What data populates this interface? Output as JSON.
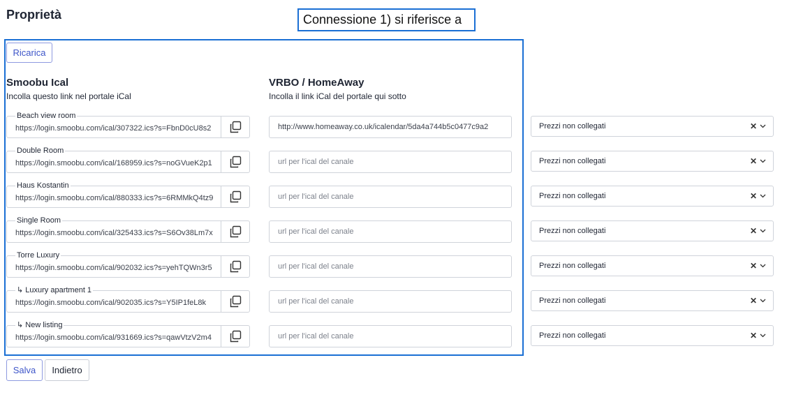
{
  "page": {
    "title": "Proprietà"
  },
  "callout": {
    "text": "Connessione 1) si riferisce a"
  },
  "buttons": {
    "reload": "Ricarica",
    "save": "Salva",
    "back": "Indietro"
  },
  "smoobu_column": {
    "heading": "Smoobu Ical",
    "subtitle": "Incolla questo link nel portale iCal"
  },
  "channel_column": {
    "heading": "VRBO / HomeAway",
    "subtitle": "Incolla il link iCal del portale qui sotto"
  },
  "rows": [
    {
      "name": "Beach view room",
      "ical_url": "https://login.smoobu.com/ical/307322.ics?s=FbnD0cU8s2",
      "channel_value": "http://www.homeaway.co.uk/icalendar/5da4a744b5c0477c9a2",
      "channel_placeholder": "url per l'ical del canale",
      "price": "Prezzi non collegati"
    },
    {
      "name": "Double Room",
      "ical_url": "https://login.smoobu.com/ical/168959.ics?s=noGVueK2p1",
      "channel_value": "",
      "channel_placeholder": "url per l'ical del canale",
      "price": "Prezzi non collegati"
    },
    {
      "name": "Haus Kostantin",
      "ical_url": "https://login.smoobu.com/ical/880333.ics?s=6RMMkQ4tz9",
      "channel_value": "",
      "channel_placeholder": "url per l'ical del canale",
      "price": "Prezzi non collegati"
    },
    {
      "name": "Single Room",
      "ical_url": "https://login.smoobu.com/ical/325433.ics?s=S6Ov38Lm7x",
      "channel_value": "",
      "channel_placeholder": "url per l'ical del canale",
      "price": "Prezzi non collegati"
    },
    {
      "name": "Torre Luxury",
      "ical_url": "https://login.smoobu.com/ical/902032.ics?s=yehTQWn3r5",
      "channel_value": "",
      "channel_placeholder": "url per l'ical del canale",
      "price": "Prezzi non collegati"
    },
    {
      "name": "↳ Luxury apartment 1",
      "ical_url": "https://login.smoobu.com/ical/902035.ics?s=Y5IP1feL8k",
      "channel_value": "",
      "channel_placeholder": "url per l'ical del canale",
      "price": "Prezzi non collegati"
    },
    {
      "name": "↳ New listing",
      "ical_url": "https://login.smoobu.com/ical/931669.ics?s=qawVtzV2m4",
      "channel_value": "",
      "channel_placeholder": "url per l'ical del canale",
      "price": "Prezzi non collegati"
    }
  ],
  "icons": {
    "copy": "copy-icon",
    "clear": "clear-icon",
    "chevron": "chevron-down-icon"
  },
  "colors": {
    "accent": "#1a6fd4",
    "primary_button": "#3d55c9"
  }
}
